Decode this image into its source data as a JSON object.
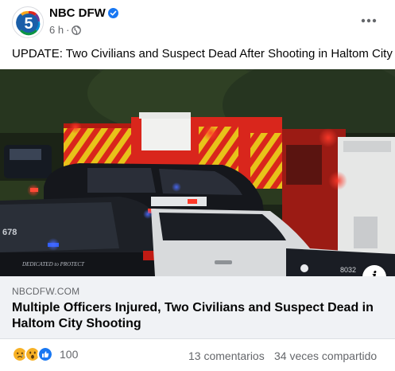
{
  "post": {
    "page_name": "NBC DFW",
    "time": "6 h",
    "separator": "·",
    "text": "UPDATE: Two Civilians and Suspect Dead After Shooting in Haltom City",
    "verified_icon": "verified-badge-icon",
    "audience_icon": "globe-icon",
    "more_icon": "more-options-icon"
  },
  "photo": {
    "unit_number": "678",
    "door_text": "DEDICATED to PROTECT",
    "plate_text": "8032",
    "info_label": "i"
  },
  "link": {
    "domain": "NBCDFW.COM",
    "title": "Multiple Officers Injured, Two Civilians and Suspect Dead in Haltom City Shooting"
  },
  "footer": {
    "reaction_icons": [
      "sad-reaction-icon",
      "wow-reaction-icon",
      "like-reaction-icon"
    ],
    "reaction_count": "100",
    "comments": "13 comentarios",
    "shares": "34 veces compartido"
  },
  "colors": {
    "brand_blue": "#1877f2",
    "secondary_text": "#65676b",
    "link_card_bg": "#f0f2f5"
  }
}
